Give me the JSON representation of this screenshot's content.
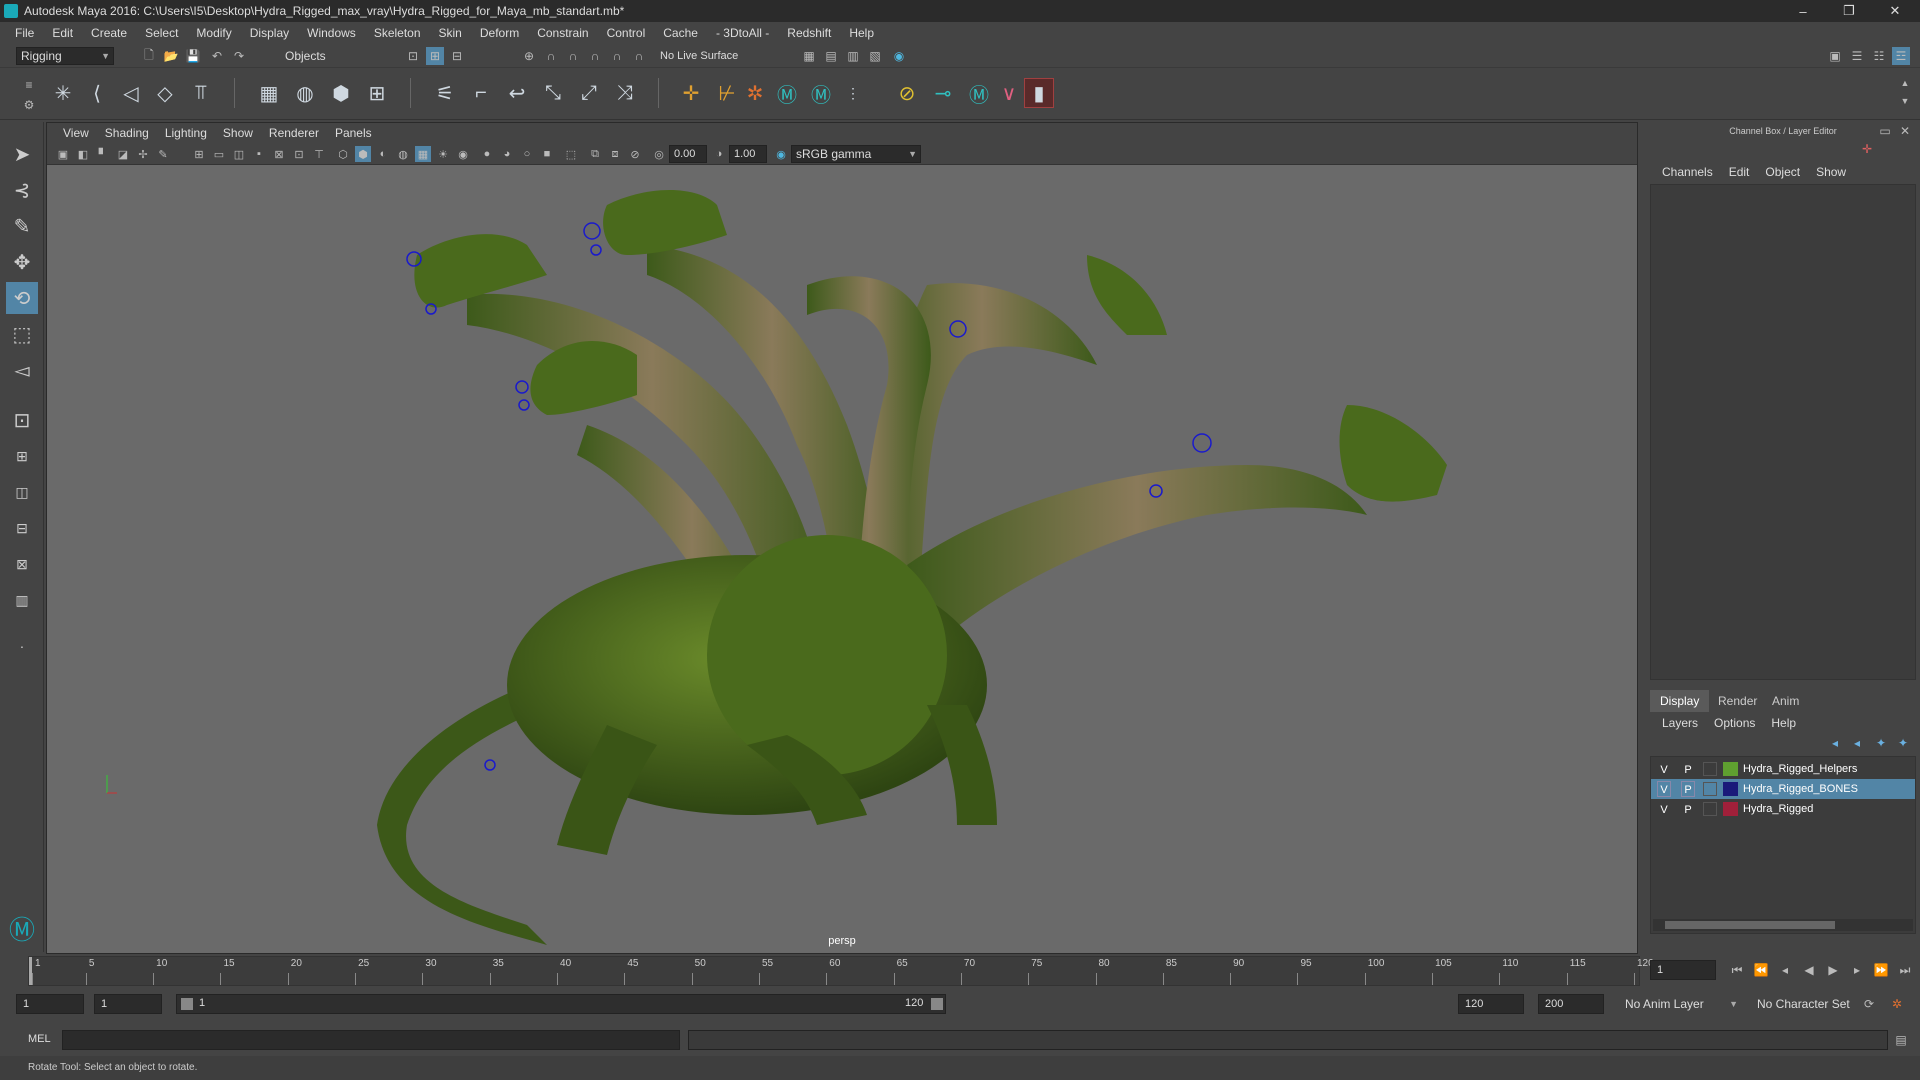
{
  "window": {
    "title": "Autodesk Maya 2016: C:\\Users\\I5\\Desktop\\Hydra_Rigged_max_vray\\Hydra_Rigged_for_Maya_mb_standart.mb*",
    "minimize": "–",
    "maximize": "❐",
    "close": "✕"
  },
  "menubar": [
    "File",
    "Edit",
    "Create",
    "Select",
    "Modify",
    "Display",
    "Windows",
    "Skeleton",
    "Skin",
    "Deform",
    "Constrain",
    "Control",
    "Cache",
    "- 3DtoAll -",
    "Redshift",
    "Help"
  ],
  "statusline": {
    "menuset": "Rigging",
    "select_mode": "Objects",
    "live_surface": "No Live Surface"
  },
  "panel": {
    "menus": [
      "View",
      "Shading",
      "Lighting",
      "Show",
      "Renderer",
      "Panels"
    ],
    "exposure": "0.00",
    "gamma": "1.00",
    "colorspace": "sRGB gamma",
    "camera_label": "persp"
  },
  "channelbox": {
    "header": "Channel Box / Layer Editor",
    "menus": [
      "Channels",
      "Edit",
      "Object",
      "Show"
    ]
  },
  "layer_editor": {
    "tabs": [
      "Display",
      "Render",
      "Anim"
    ],
    "active_tab": "Display",
    "menus": [
      "Layers",
      "Options",
      "Help"
    ],
    "layers": [
      {
        "v": "V",
        "p": "P",
        "name": "Hydra_Rigged_Helpers",
        "color": "#5fa030",
        "selected": false
      },
      {
        "v": "V",
        "p": "P",
        "name": "Hydra_Rigged_BONES",
        "color": "#1a1a7a",
        "selected": true
      },
      {
        "v": "V",
        "p": "P",
        "name": "Hydra_Rigged",
        "color": "#a0203a",
        "selected": false
      }
    ]
  },
  "timeline": {
    "ticks": [
      "1",
      "5",
      "10",
      "15",
      "20",
      "25",
      "30",
      "35",
      "40",
      "45",
      "50",
      "55",
      "60",
      "65",
      "70",
      "75",
      "80",
      "85",
      "90",
      "95",
      "100",
      "105",
      "110",
      "115",
      "120"
    ],
    "current_frame": "1",
    "range_start": "1",
    "playback_start": "1",
    "slider_start": "1",
    "slider_end": "120",
    "playback_end": "120",
    "anim_end": "200",
    "anim_layer": "No Anim Layer",
    "character_set": "No Character Set"
  },
  "commandline": {
    "label": "MEL"
  },
  "helpline": {
    "text": "Rotate Tool: Select an object to rotate."
  },
  "colors": {
    "ui_bg": "#444444",
    "viewport_bg": "#6a6a6a",
    "selection": "#5285a6",
    "maya_teal": "#1aa9b8"
  }
}
